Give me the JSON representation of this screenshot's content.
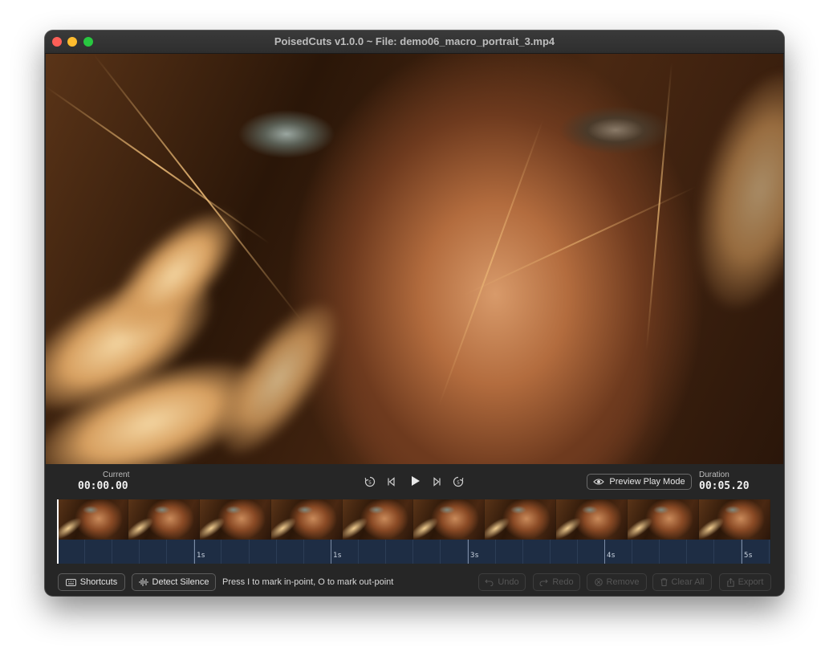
{
  "window": {
    "title": "PoisedCuts v1.0.0 ~ File: demo06_macro_portrait_3.mp4"
  },
  "player": {
    "current_label": "Current",
    "current_time": "00:00.00",
    "duration_label": "Duration",
    "duration_time": "00:05.20",
    "preview_label": "Preview Play Mode",
    "controls": [
      "rewind-5-icon",
      "step-back-icon",
      "play-icon",
      "step-forward-icon",
      "forward-5-icon"
    ]
  },
  "timeline": {
    "thumbnail_count": 10,
    "second_labels": [
      "1s",
      "1s",
      "3s",
      "4s",
      "5s"
    ],
    "playhead_position_s": 0
  },
  "toolbar": {
    "shortcuts_label": "Shortcuts",
    "detect_silence_label": "Detect Silence",
    "hint": "Press I to mark in-point, O to mark out-point",
    "undo_label": "Undo",
    "redo_label": "Redo",
    "remove_label": "Remove",
    "clear_all_label": "Clear All",
    "export_label": "Export"
  }
}
